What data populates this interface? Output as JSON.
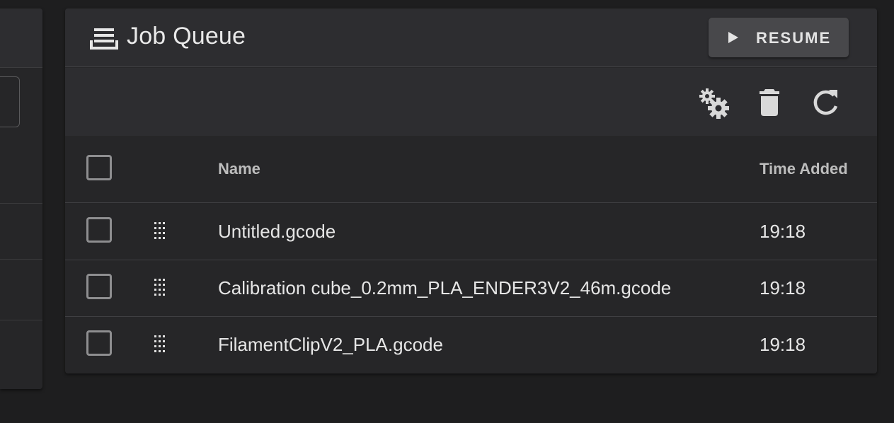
{
  "queue": {
    "title": "Job Queue",
    "resume_label": "RESUME",
    "columns": {
      "name": "Name",
      "time_added": "Time Added"
    },
    "jobs": [
      {
        "name": "Untitled.gcode",
        "time_added": "19:18"
      },
      {
        "name": "Calibration cube_0.2mm_PLA_ENDER3V2_46m.gcode",
        "time_added": "19:18"
      },
      {
        "name": "FilamentClipV2_PLA.gcode",
        "time_added": "19:18"
      }
    ],
    "icons": {
      "title": "tray-full-icon",
      "resume": "play-icon",
      "settings": "cogs-icon",
      "delete": "delete-icon",
      "refresh": "refresh-icon",
      "drag": "drag-handle-icon"
    }
  },
  "colors": {
    "background": "#1e1e1f",
    "card": "#262628",
    "header": "#2d2d30",
    "button": "#48484b",
    "text": "#e6e6e6",
    "muted_text": "#bdbdbd"
  }
}
